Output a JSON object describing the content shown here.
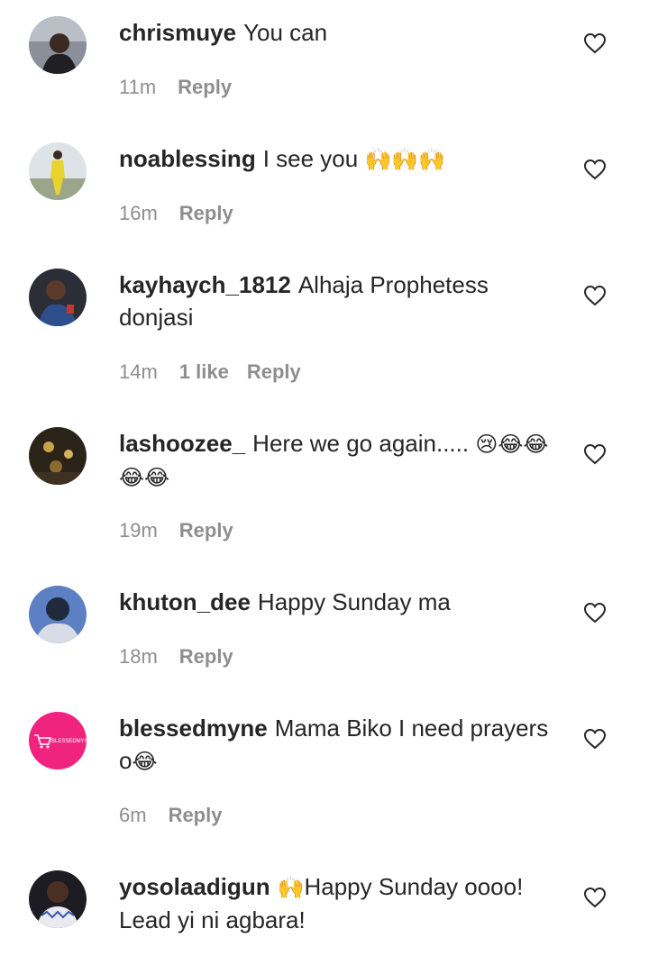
{
  "comments": [
    {
      "username": "chrismuye",
      "text": "You can",
      "emoji": "",
      "time": "11m",
      "likes": "",
      "reply": "Reply"
    },
    {
      "username": "noablessing",
      "text": "I see you ",
      "emoji": "🙌🙌🙌",
      "time": "16m",
      "likes": "",
      "reply": "Reply"
    },
    {
      "username": "kayhaych_1812",
      "text": "Alhaja Prophetess donjasi",
      "emoji": "",
      "time": "14m",
      "likes": "1 like",
      "reply": "Reply"
    },
    {
      "username": "lashoozee_",
      "text": "Here we go again..... ",
      "emoji": "😢😂😂😂😂",
      "time": "19m",
      "likes": "",
      "reply": "Reply"
    },
    {
      "username": "khuton_dee",
      "text": "Happy Sunday ma",
      "emoji": "",
      "time": "18m",
      "likes": "",
      "reply": "Reply"
    },
    {
      "username": "blessedmyne",
      "text": "Mama Biko I need prayers o",
      "emoji": "😂",
      "time": "6m",
      "likes": "",
      "reply": "Reply"
    },
    {
      "username": "yosolaadigun",
      "text": "Happy Sunday oooo! Lead yi ni agbara!",
      "emoji": "🙌",
      "time": "",
      "likes": "",
      "reply": ""
    }
  ],
  "avatars": {
    "blessedmyne_logo_text": "BLESSEDMYNE"
  },
  "colors": {
    "text": "#262626",
    "meta": "#8e8e8e",
    "blessedmyne_bg": "#f0247f"
  },
  "icons": [
    "heart-outline-icon"
  ]
}
